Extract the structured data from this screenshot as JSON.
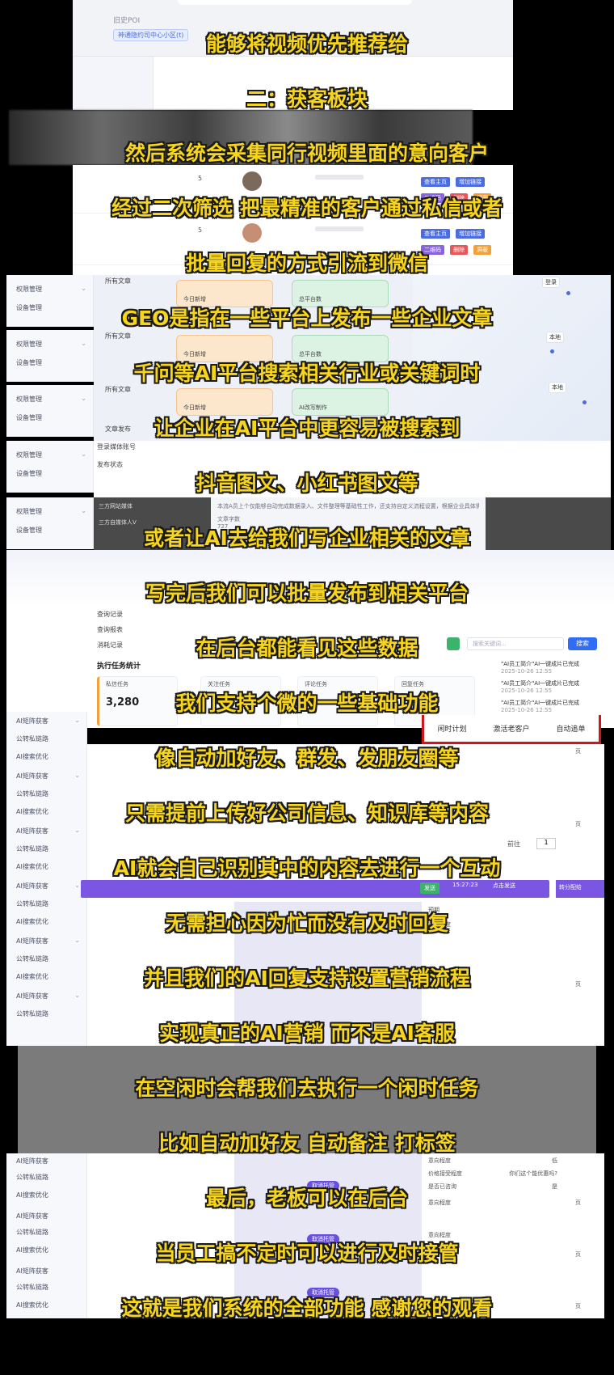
{
  "header": {
    "history_label": "旧史POI",
    "location_pill": "神通隐约司中心小区(t)"
  },
  "table": {
    "rows": [
      {
        "num": "5",
        "tags": [
          "查看主页",
          "增加链接",
          "二维码",
          "删除",
          "屏蔽"
        ]
      },
      {
        "num": "5",
        "tags": [
          "查看主页",
          "增加链接",
          "二维码",
          "删除",
          "屏蔽"
        ]
      }
    ]
  },
  "sidebar": {
    "items": [
      "权限管理",
      "设备管理"
    ]
  },
  "articles": {
    "all_articles": "所有文章",
    "today_new": "今日新增",
    "total": "总平台数",
    "ai_writing": "AI改写制作",
    "article_publish": "文章发布",
    "login_media": "登录媒体账号",
    "publish_state": "发布状态",
    "note_count": "文章字数",
    "note_value": "727",
    "local": "本地",
    "login": "登录"
  },
  "dark_panel_text": "本流A员上个仅能够自动完成数据录入、文件整理等基础性工作，还支持自定义流程设置，根据企业具体需求进行配置使用，会员、通讯器专家也可通过A员上的专业性，提供更专业服务。",
  "sidebar2_items": [
    "三方网站媒体",
    "三方自媒体人V"
  ],
  "records": {
    "menu": [
      "查询记录",
      "查询报表",
      "消耗记录"
    ],
    "section_title": "执行任务统计",
    "card1_label": "私信任务",
    "card1_value": "3,280",
    "card2_label": "关注任务",
    "card3_label": "评论任务",
    "card4_label": "回复任务",
    "search_placeholder": "搜索关键词...",
    "search_button": "搜索",
    "news": [
      {
        "title": "\"AI员工简介\"AI一键成片已完成",
        "date": "2025-10-26 12:55"
      },
      {
        "title": "\"AI员工简介\"AI一键成片已完成",
        "date": "2025-10-26 12:55"
      },
      {
        "title": "\"AI员工简介\"AI一键成片已完成",
        "date": "2025-10-26 12:55"
      }
    ],
    "tabs": [
      "闲时计划",
      "激活老客户",
      "自动追单"
    ]
  },
  "sidebar3": {
    "items": [
      "AI矩阵获客",
      "公转私链路",
      "AI搜索优化"
    ]
  },
  "chat": {
    "cancel": "取消托管",
    "labels": [
      "意向程度",
      "价格接受程度",
      "是否已咨询",
      "预期",
      "意向程度"
    ],
    "values": [
      "低",
      "你们这个能优惠吗?",
      "是"
    ],
    "page_unit": "页",
    "prev_label": "前往",
    "page_value": "1",
    "send_label": "发送",
    "time": "15:27:23",
    "close_hint": "点击发送",
    "transfer": "转分配给",
    "aggregate": "聚合数据"
  },
  "subtitles": [
    "能够将视频优先推荐给",
    "二：获客板块",
    "然后系统会采集同行视频里面的意向客户",
    "经过二次筛选 把最精准的客户通过私信或者",
    "批量回复的方式引流到微信",
    "GEO是指在一些平台上发布一些企业文章",
    "千问等AI平台搜索相关行业或关键词时",
    "让企业在AI平台中更容易被搜索到",
    "抖音图文、小红书图文等",
    "或者让AI去给我们写企业相关的文章",
    "写完后我们可以批量发布到相关平台",
    "在后台都能看见这些数据",
    "我们支持个微的一些基础功能",
    "像自动加好友、群发、发朋友圈等",
    "只需提前上传好公司信息、知识库等内容",
    "AI就会自己识别其中的内容去进行一个互动",
    "无需担心因为忙而没有及时回复",
    "并且我们的AI回复支持设置营销流程",
    "实现真正的AI营销 而不是AI客服",
    "在空闲时会帮我们去执行一个闲时任务",
    "比如自动加好友 自动备注 打标签",
    "最后，老板可以在后台",
    "当员工搞不定时可以进行及时接管",
    "这就是我们系统的全部功能 感谢您的观看"
  ],
  "colors": {
    "subtitle": "#f7d51c",
    "accent": "#4b6ce0",
    "purple": "#7a56e2",
    "highlight_border": "#d0161b"
  }
}
